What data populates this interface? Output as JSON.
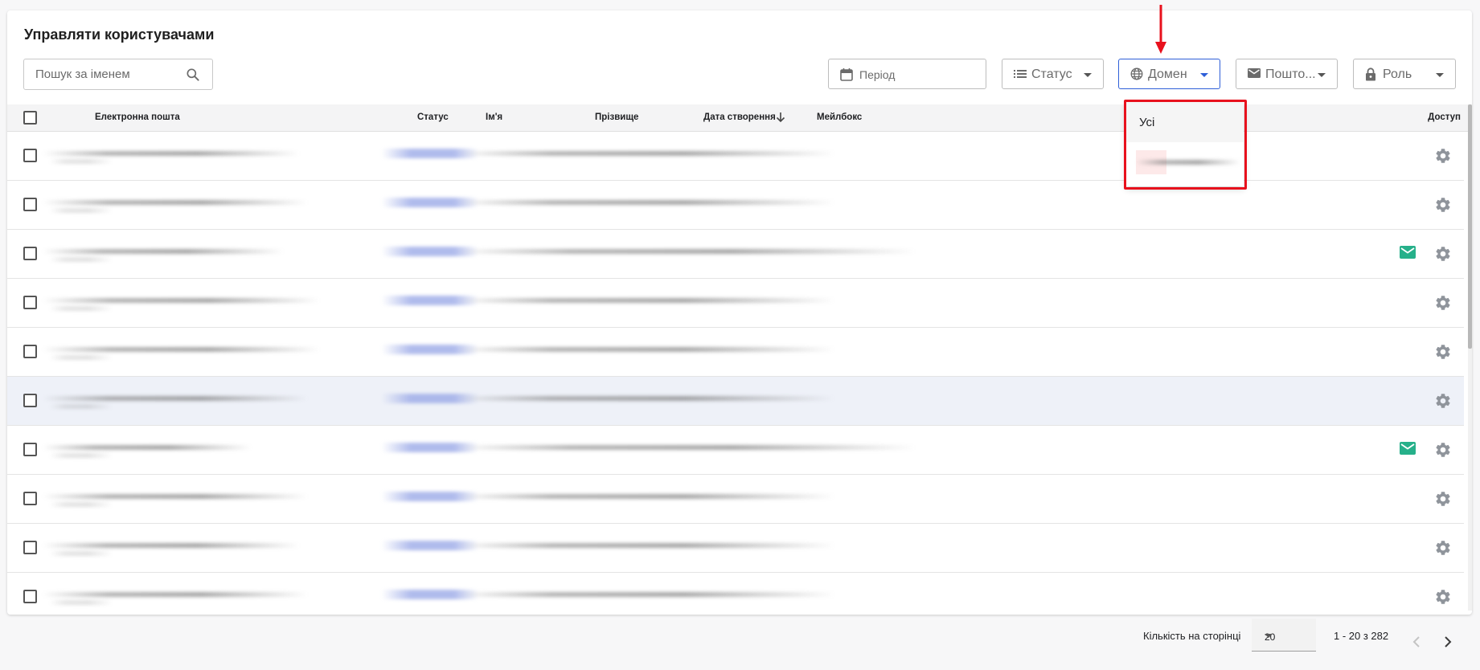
{
  "page": {
    "title": "Управляти користувачами"
  },
  "search": {
    "placeholder": "Пошук за іменем",
    "icon": "search-icon"
  },
  "filters": {
    "period": {
      "label": "Період",
      "icon": "calendar-icon"
    },
    "status": {
      "label": "Статус",
      "icon": "list-icon"
    },
    "domain": {
      "label": "Домен",
      "icon": "globe-icon",
      "open": true
    },
    "mailbox": {
      "label": "Пошто...",
      "icon": "mail-icon"
    },
    "role": {
      "label": "Роль",
      "icon": "lock-icon"
    }
  },
  "domain_dropdown": {
    "options": [
      "Усі"
    ]
  },
  "table": {
    "columns": {
      "email": "Електронна пошта",
      "status": "Статус",
      "first_name": "Ім'я",
      "last_name": "Прізвище",
      "created": "Дата створення",
      "mailbox": "Мейлбокс",
      "access": "Доступ"
    },
    "sort": {
      "column": "created",
      "direction": "desc",
      "icon": "arrow-down-icon"
    },
    "rows": [
      {
        "mail_icon": false,
        "highlighted": false
      },
      {
        "mail_icon": false,
        "highlighted": false
      },
      {
        "mail_icon": true,
        "highlighted": false
      },
      {
        "mail_icon": false,
        "highlighted": false
      },
      {
        "mail_icon": false,
        "highlighted": false
      },
      {
        "mail_icon": false,
        "highlighted": true
      },
      {
        "mail_icon": true,
        "highlighted": false
      },
      {
        "mail_icon": false,
        "highlighted": false
      },
      {
        "mail_icon": false,
        "highlighted": false
      },
      {
        "mail_icon": false,
        "highlighted": false
      }
    ]
  },
  "pagination": {
    "per_page_label": "Кількість на сторінці",
    "per_page_value": "20",
    "range": "1 - 20 з 282"
  },
  "colors": {
    "accent": "#2e5fd8",
    "mail_icon": "#26b08a",
    "annotation": "#e8111d",
    "gear": "#8f949b"
  }
}
